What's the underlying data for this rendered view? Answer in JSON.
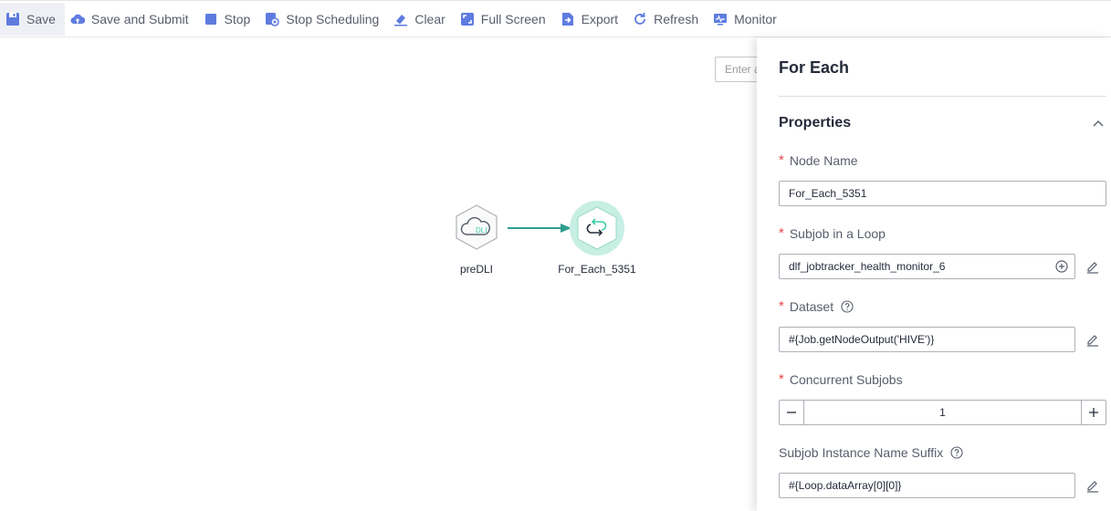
{
  "toolbar": {
    "save": "Save",
    "save_submit": "Save and Submit",
    "stop": "Stop",
    "stop_scheduling": "Stop Scheduling",
    "clear": "Clear",
    "full_screen": "Full Screen",
    "export": "Export",
    "refresh": "Refresh",
    "monitor": "Monitor"
  },
  "canvas": {
    "search_placeholder": "Enter a",
    "nodes": [
      {
        "label": "preDLI",
        "icon": "dli-cloud-icon",
        "badge": "DLI"
      },
      {
        "label": "For_Each_5351",
        "icon": "loop-icon"
      }
    ]
  },
  "panel": {
    "title": "For Each",
    "section": "Properties",
    "fields": {
      "node_name": {
        "label": "Node Name",
        "value": "For_Each_5351"
      },
      "subjob": {
        "label": "Subjob in a Loop",
        "value": "dlf_jobtracker_health_monitor_6"
      },
      "dataset": {
        "label": "Dataset",
        "value": "#{Job.getNodeOutput('HIVE')}"
      },
      "concurrent": {
        "label": "Concurrent Subjobs",
        "value": "1"
      },
      "suffix": {
        "label": "Subjob Instance Name Suffix",
        "value": "#{Loop.dataArray[0][0]}"
      }
    }
  },
  "colors": {
    "accent": "#5e7ce0",
    "node_active": "#3dcca6",
    "required": "#e5484d"
  }
}
